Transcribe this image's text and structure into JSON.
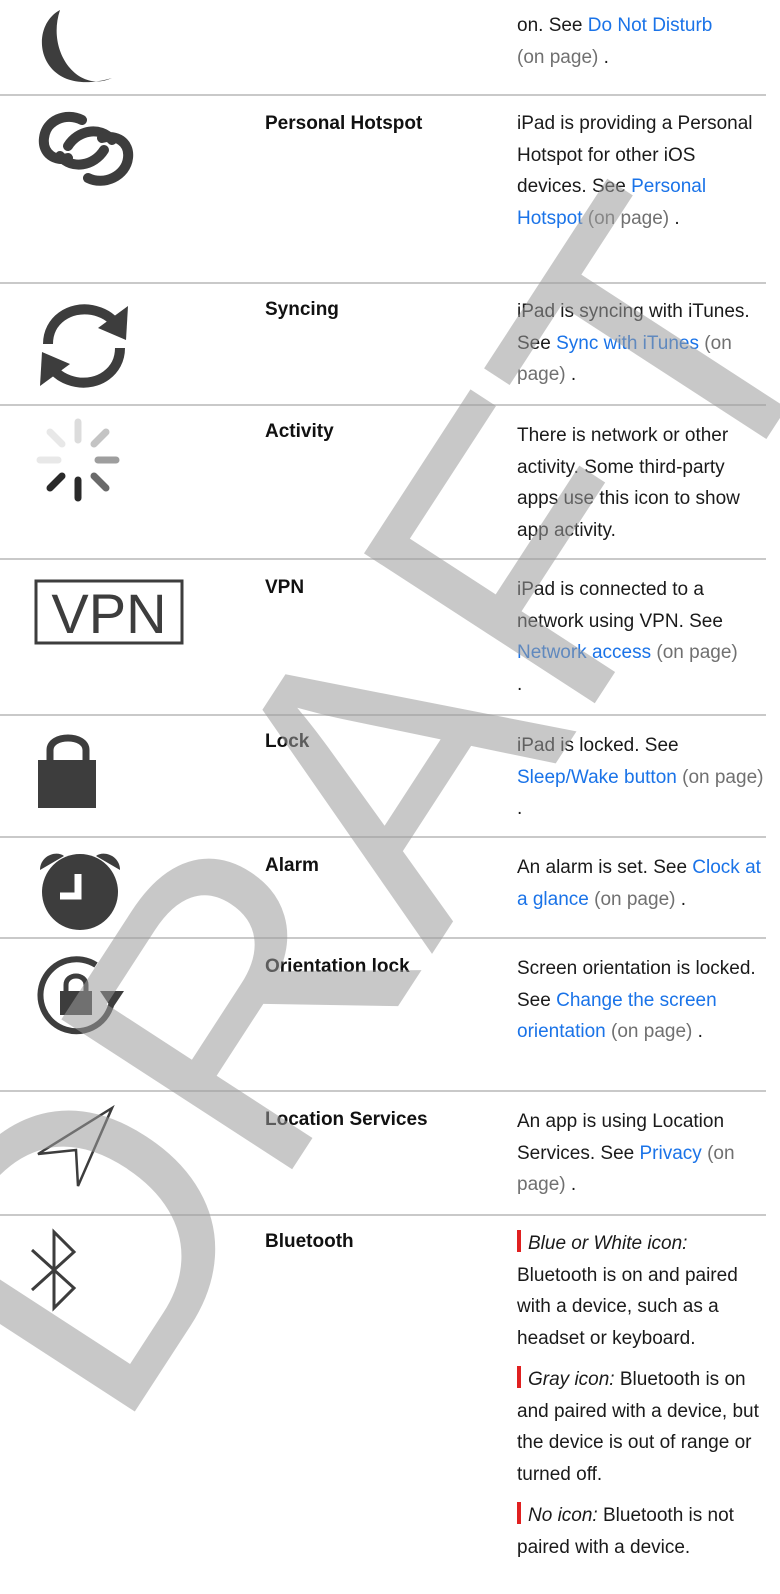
{
  "rows": [
    {
      "name": "",
      "desc_pre": "on. See ",
      "link": "Do Not Disturb",
      "ref": "(on page)",
      "post": " ."
    },
    {
      "name": "Personal Hotspot",
      "desc_pre": "iPad is providing a Personal Hotspot for other iOS devices. See ",
      "link": "Personal Hotspot",
      "ref": "(on page)",
      "post": " ."
    },
    {
      "name": "Syncing",
      "desc_pre": "iPad is syncing with iTunes. See ",
      "link": "Sync with iTunes",
      "ref": "(on page)",
      "post": " ."
    },
    {
      "name": "Activity",
      "desc_pre": "There is network or other activity. Some third-party apps use this icon to show app activity.",
      "link": "",
      "ref": "",
      "post": ""
    },
    {
      "name": "VPN",
      "desc_pre": "iPad is connected to a network using VPN. See ",
      "link": "Network access",
      "ref": "(on page)",
      "post": " ."
    },
    {
      "name": "Lock",
      "desc_pre": "iPad is locked. See ",
      "link": "Sleep/Wake button",
      "ref": "(on page)",
      "post": " ."
    },
    {
      "name": "Alarm",
      "desc_pre": "An alarm is set. See ",
      "link": "Clock at a glance",
      "ref": "(on page)",
      "post": " ."
    },
    {
      "name": "Orientation lock",
      "desc_pre": "Screen orientation is locked. See ",
      "link": "Change the screen orientation",
      "ref": "(on page)",
      "post": " ."
    },
    {
      "name": "Location Services",
      "desc_pre": "An app is using Location Services. See ",
      "link": "Privacy",
      "ref": "(on page)",
      "post": " ."
    },
    {
      "name": "Bluetooth",
      "desc_pre": "",
      "link": "",
      "ref": "",
      "post": ""
    }
  ],
  "vpn_label": "VPN",
  "bluetooth": [
    {
      "label": "Blue or White icon:",
      "text": " Bluetooth is on and paired with a device, such as a headset or keyboard."
    },
    {
      "label": "Gray icon:",
      "text": " Bluetooth is on and paired with a device, but the device is out of range or turned off."
    },
    {
      "label": "No icon:",
      "text": " Bluetooth is not paired with a device."
    }
  ],
  "watermark": "DRAFT",
  "colors": {
    "link": "#1a73e8",
    "icon": "#3d3d3d",
    "bar": "#e02020",
    "watermark": "#9a9a9a"
  }
}
